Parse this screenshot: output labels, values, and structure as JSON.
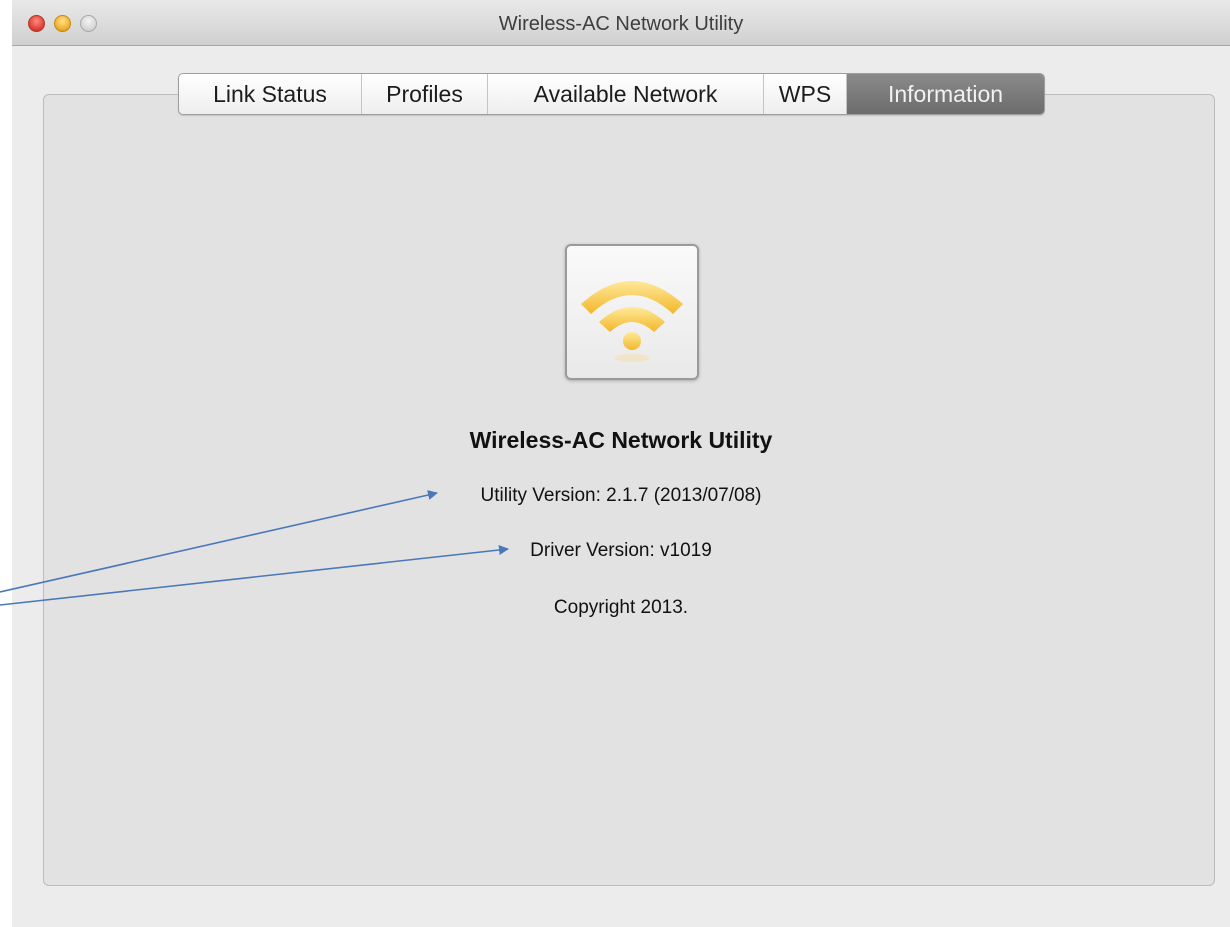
{
  "window": {
    "title": "Wireless-AC Network Utility"
  },
  "tabs": [
    {
      "label": "Link Status",
      "active": false
    },
    {
      "label": "Profiles",
      "active": false
    },
    {
      "label": "Available Network",
      "active": false
    },
    {
      "label": "WPS",
      "active": false
    },
    {
      "label": "Information",
      "active": true
    }
  ],
  "info": {
    "app_name": "Wireless-AC Network Utility",
    "utility_version": "Utility Version: 2.1.7 (2013/07/08)",
    "driver_version": "Driver Version: v1019",
    "copyright": "Copyright 2013.",
    "icon": "wifi-icon"
  },
  "colors": {
    "active_tab": "#7a7a7a",
    "wifi_icon": "#f5c23a",
    "annotation_arrow": "#4a78b8"
  }
}
